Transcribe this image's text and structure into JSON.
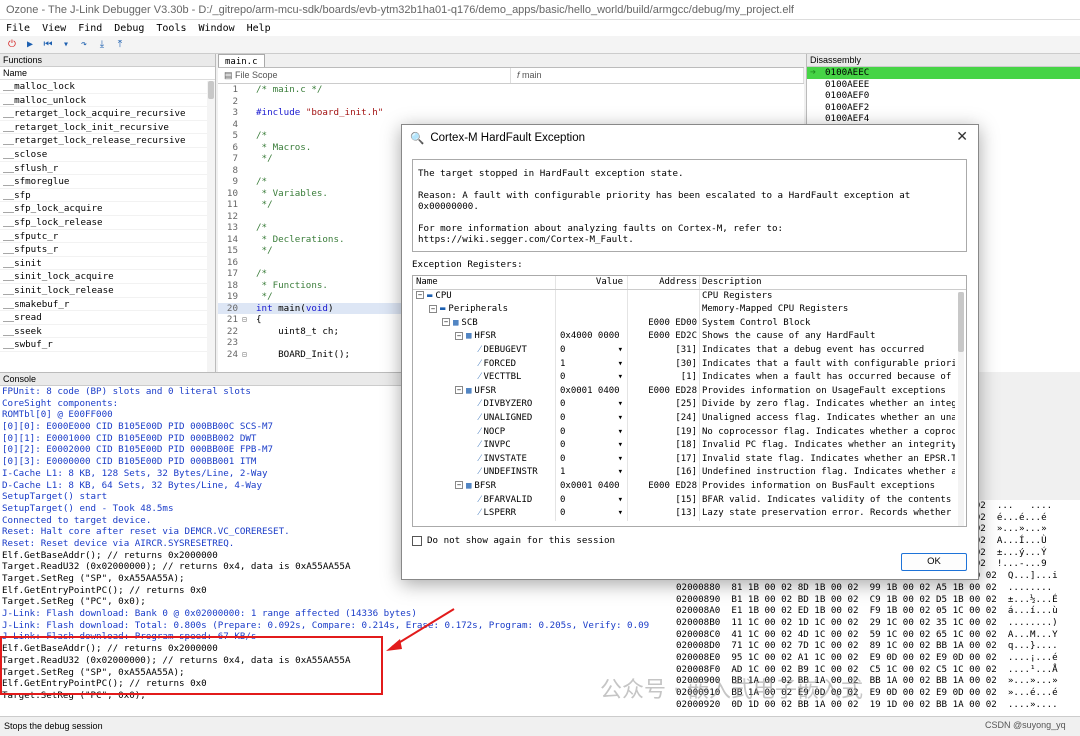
{
  "window": {
    "title": "Ozone - The J-Link Debugger V3.30b - D:/_gitrepo/arm-mcu-sdk/boards/evb-ytm32b1ha01-q176/demo_apps/basic/hello_world/build/armgcc/debug/my_project.elf"
  },
  "menu": [
    "File",
    "View",
    "Find",
    "Debug",
    "Tools",
    "Window",
    "Help"
  ],
  "functions": {
    "title": "Functions",
    "column": "Name",
    "items": [
      "__malloc_lock",
      "__malloc_unlock",
      "__retarget_lock_acquire_recursive",
      "__retarget_lock_init_recursive",
      "__retarget_lock_release_recursive",
      "__sclose",
      "__sflush_r",
      "__sfmoreglue",
      "__sfp",
      "__sfp_lock_acquire",
      "__sfp_lock_release",
      "__sfputc_r",
      "__sfputs_r",
      "__sinit",
      "__sinit_lock_acquire",
      "__sinit_lock_release",
      "__smakebuf_r",
      "__sread",
      "__sseek",
      "__swbuf_r"
    ]
  },
  "editor": {
    "tab": "main.c",
    "scope_file": "File Scope",
    "scope_func": "main",
    "lines": [
      {
        "n": "1",
        "t": "/* main.c */",
        "c": "cm"
      },
      {
        "n": "2",
        "t": "",
        "c": ""
      },
      {
        "n": "3",
        "t": "#include \"board_init.h\"",
        "c": "inc"
      },
      {
        "n": "4",
        "t": "",
        "c": ""
      },
      {
        "n": "5",
        "t": "/*",
        "c": "cm"
      },
      {
        "n": "6",
        "t": " * Macros.",
        "c": "cm"
      },
      {
        "n": "7",
        "t": " */",
        "c": "cm"
      },
      {
        "n": "8",
        "t": "",
        "c": ""
      },
      {
        "n": "9",
        "t": "/*",
        "c": "cm"
      },
      {
        "n": "10",
        "t": " * Variables.",
        "c": "cm"
      },
      {
        "n": "11",
        "t": " */",
        "c": "cm"
      },
      {
        "n": "12",
        "t": "",
        "c": ""
      },
      {
        "n": "13",
        "t": "/*",
        "c": "cm"
      },
      {
        "n": "14",
        "t": " * Declerations.",
        "c": "cm"
      },
      {
        "n": "15",
        "t": " */",
        "c": "cm"
      },
      {
        "n": "16",
        "t": "",
        "c": ""
      },
      {
        "n": "17",
        "t": "/*",
        "c": "cm"
      },
      {
        "n": "18",
        "t": " * Functions.",
        "c": "cm"
      },
      {
        "n": "19",
        "t": " */",
        "c": "cm"
      },
      {
        "n": "20",
        "t": "int main(void)",
        "c": "kwl"
      },
      {
        "n": "21",
        "t": "{",
        "c": ""
      },
      {
        "n": "22",
        "t": "    uint8_t ch;",
        "c": ""
      },
      {
        "n": "23",
        "t": "",
        "c": ""
      },
      {
        "n": "24",
        "t": "    BOARD_Init();",
        "c": ""
      }
    ]
  },
  "disassembly": {
    "title": "Disassembly",
    "lines": [
      "0100AEEC",
      "0100AEEE",
      "0100AEF0",
      "0100AEF2",
      "0100AEF4"
    ]
  },
  "console": {
    "title": "Console",
    "lines": [
      "FPUnit: 8 code (BP) slots and 0 literal slots",
      "CoreSight components:",
      "ROMTbl[0] @ E00FF000",
      "[0][0]: E000E000 CID B105E00D PID 000BB00C SCS-M7",
      "[0][1]: E0001000 CID B105E00D PID 000BB002 DWT",
      "[0][2]: E0002000 CID B105E00D PID 000BB00E FPB-M7",
      "[0][3]: E0000000 CID B105E00D PID 000BB001 ITM",
      "I-Cache L1: 8 KB, 128 Sets, 32 Bytes/Line, 2-Way",
      "D-Cache L1: 8 KB, 64 Sets, 32 Bytes/Line, 4-Way",
      "SetupTarget() start",
      "SetupTarget() end - Took 48.5ms",
      "Connected to target device.",
      "Reset: Halt core after reset via DEMCR.VC_CORERESET.",
      "Reset: Reset device via AIRCR.SYSRESETREQ.",
      "Elf.GetBaseAddr(); // returns 0x2000000",
      "Target.ReadU32 (0x02000000); // returns 0x4, data is 0xA55AA55A",
      "Target.SetReg (\"SP\", 0xA55AA55A);",
      "Elf.GetEntryPointPC(); // returns 0x0",
      "Target.SetReg (\"PC\", 0x0);",
      "J-Link: Flash download: Bank 0 @ 0x02000000: 1 range affected (14336 bytes)",
      "J-Link: Flash download: Total: 0.800s (Prepare: 0.092s, Compare: 0.214s, Erase: 0.172s, Program: 0.205s, Verify: 0.09",
      "J-Link: Flash download: Program speed: 67 KB/s",
      "Elf.GetBaseAddr(); // returns 0x2000000",
      "Target.ReadU32 (0x02000000); // returns 0x4, data is 0xA55AA55A",
      "Target.SetReg (\"SP\", 0xA55AA55A);",
      "Elf.GetEntryPointPC(); // returns 0x0",
      "Target.SetReg (\"PC\", 0x0);"
    ]
  },
  "memory": {
    "lines": [
      "                                                   00 02  ...   ....",
      "                                                   00 02  é...é...é",
      "                                                   00 02  »...»...»",
      "                                                   00 02  A...Í...Ù",
      "                                                   00 02  ±...ý...Ý",
      "                                                   00 02  !...-...9",
      "02000870  51 1B 00 02 5D 1B 00 02  69 1B 00 02 75 1B 00 02  Q...]...i",
      "02000880  81 1B 00 02 8D 1B 00 02  99 1B 00 02 A5 1B 00 02  ........",
      "02000890  B1 1B 00 02 BD 1B 00 02  C9 1B 00 02 D5 1B 00 02  ±...½...É",
      "020008A0  E1 1B 00 02 ED 1B 00 02  F9 1B 00 02 05 1C 00 02  á...í...ù",
      "020008B0  11 1C 00 02 1D 1C 00 02  29 1C 00 02 35 1C 00 02  ........)",
      "020008C0  41 1C 00 02 4D 1C 00 02  59 1C 00 02 65 1C 00 02  A...M...Y",
      "020008D0  71 1C 00 02 7D 1C 00 02  89 1C 00 02 BB 1A 00 02  q...}....",
      "020008E0  95 1C 00 02 A1 1C 00 02  E9 0D 00 02 E9 0D 00 02  ....¡...é",
      "020008F0  AD 1C 00 02 B9 1C 00 02  C5 1C 00 02 C5 1C 00 02  ....¹...Å",
      "02000900  BB 1A 00 02 BB 1A 00 02  BB 1A 00 02 BB 1A 00 02  »...»...»",
      "02000910  BB 1A 00 02 E9 0D 00 02  E9 0D 00 02 E9 0D 00 02  »...é...é",
      "02000920  0D 1D 00 02 BB 1A 00 02  19 1D 00 02 BB 1A 00 02  ....»...."
    ]
  },
  "dialog": {
    "title": "Cortex-M HardFault Exception",
    "msg1": "The target stopped in HardFault exception state.",
    "msg2": "Reason: A fault with configurable priority has been escalated to a HardFault exception at 0x00000000.",
    "msg3": "For more information about analyzing faults on Cortex-M, refer to:",
    "msg4": "https://wiki.segger.com/Cortex-M_Fault.",
    "regs_label": "Exception Registers:",
    "columns": [
      "Name",
      "Value",
      "Address",
      "Description"
    ],
    "rows": [
      {
        "name": "CPU",
        "value": "",
        "addr": "",
        "desc": "CPU Registers",
        "lvl": 0,
        "exp": "−",
        "dd": false
      },
      {
        "name": "Peripherals",
        "value": "",
        "addr": "",
        "desc": "Memory-Mapped CPU Registers",
        "lvl": 1,
        "exp": "−",
        "dd": false
      },
      {
        "name": "SCB",
        "value": "",
        "addr": "E000 ED00",
        "desc": "System Control Block",
        "lvl": 2,
        "exp": "−",
        "dd": false
      },
      {
        "name": "HFSR",
        "value": "0x4000 0000",
        "addr": "E000 ED2C",
        "desc": "Shows the cause of any HardFault",
        "lvl": 3,
        "exp": "−",
        "dd": false
      },
      {
        "name": "DEBUGEVT",
        "value": "0",
        "addr": "[31]",
        "desc": "Indicates that a debug event has occurred",
        "lvl": 4,
        "exp": "",
        "dd": true
      },
      {
        "name": "FORCED",
        "value": "1",
        "addr": "[30]",
        "desc": "Indicates that a fault with configurable priority",
        "lvl": 4,
        "exp": "",
        "dd": true
      },
      {
        "name": "VECTTBL",
        "value": "0",
        "addr": "[1]",
        "desc": "Indicates when a fault has occurred because of a v",
        "lvl": 4,
        "exp": "",
        "dd": true
      },
      {
        "name": "UFSR",
        "value": "0x0001 0400",
        "addr": "E000 ED28",
        "desc": "Provides information on UsageFault exceptions",
        "lvl": 3,
        "exp": "−",
        "dd": false
      },
      {
        "name": "DIVBYZERO",
        "value": "0",
        "addr": "[25]",
        "desc": "Divide by zero flag. Indicates whether an integer",
        "lvl": 4,
        "exp": "",
        "dd": true
      },
      {
        "name": "UNALIGNED",
        "value": "0",
        "addr": "[24]",
        "desc": "Unaligned access flag. Indicates whether an unalig",
        "lvl": 4,
        "exp": "",
        "dd": true
      },
      {
        "name": "NOCP",
        "value": "0",
        "addr": "[19]",
        "desc": "No coprocessor flag. Indicates whether a coprocess",
        "lvl": 4,
        "exp": "",
        "dd": true
      },
      {
        "name": "INVPC",
        "value": "0",
        "addr": "[18]",
        "desc": "Invalid PC flag. Indicates whether an integrity ch",
        "lvl": 4,
        "exp": "",
        "dd": true
      },
      {
        "name": "INVSTATE",
        "value": "0",
        "addr": "[17]",
        "desc": "Invalid state flag. Indicates whether an EPSR.T or",
        "lvl": 4,
        "exp": "",
        "dd": true
      },
      {
        "name": "UNDEFINSTR",
        "value": "1",
        "addr": "[16]",
        "desc": "Undefined instruction flag. Indicates whether an u",
        "lvl": 4,
        "exp": "",
        "dd": true
      },
      {
        "name": "BFSR",
        "value": "0x0001 0400",
        "addr": "E000 ED28",
        "desc": "Provides information on BusFault exceptions",
        "lvl": 3,
        "exp": "−",
        "dd": false
      },
      {
        "name": "BFARVALID",
        "value": "0",
        "addr": "[15]",
        "desc": "BFAR valid. Indicates validity of the contents of",
        "lvl": 4,
        "exp": "",
        "dd": true
      },
      {
        "name": "LSPERR",
        "value": "0",
        "addr": "[13]",
        "desc": "Lazy state preservation error. Records whether a B",
        "lvl": 4,
        "exp": "",
        "dd": true
      }
    ],
    "checkbox": "Do not show again for this session",
    "ok": "OK"
  },
  "status": "Stops the debug session",
  "watermark": "公众号 · 嵌入式电子嵌入式",
  "credit": "CSDN @suyong_yq"
}
